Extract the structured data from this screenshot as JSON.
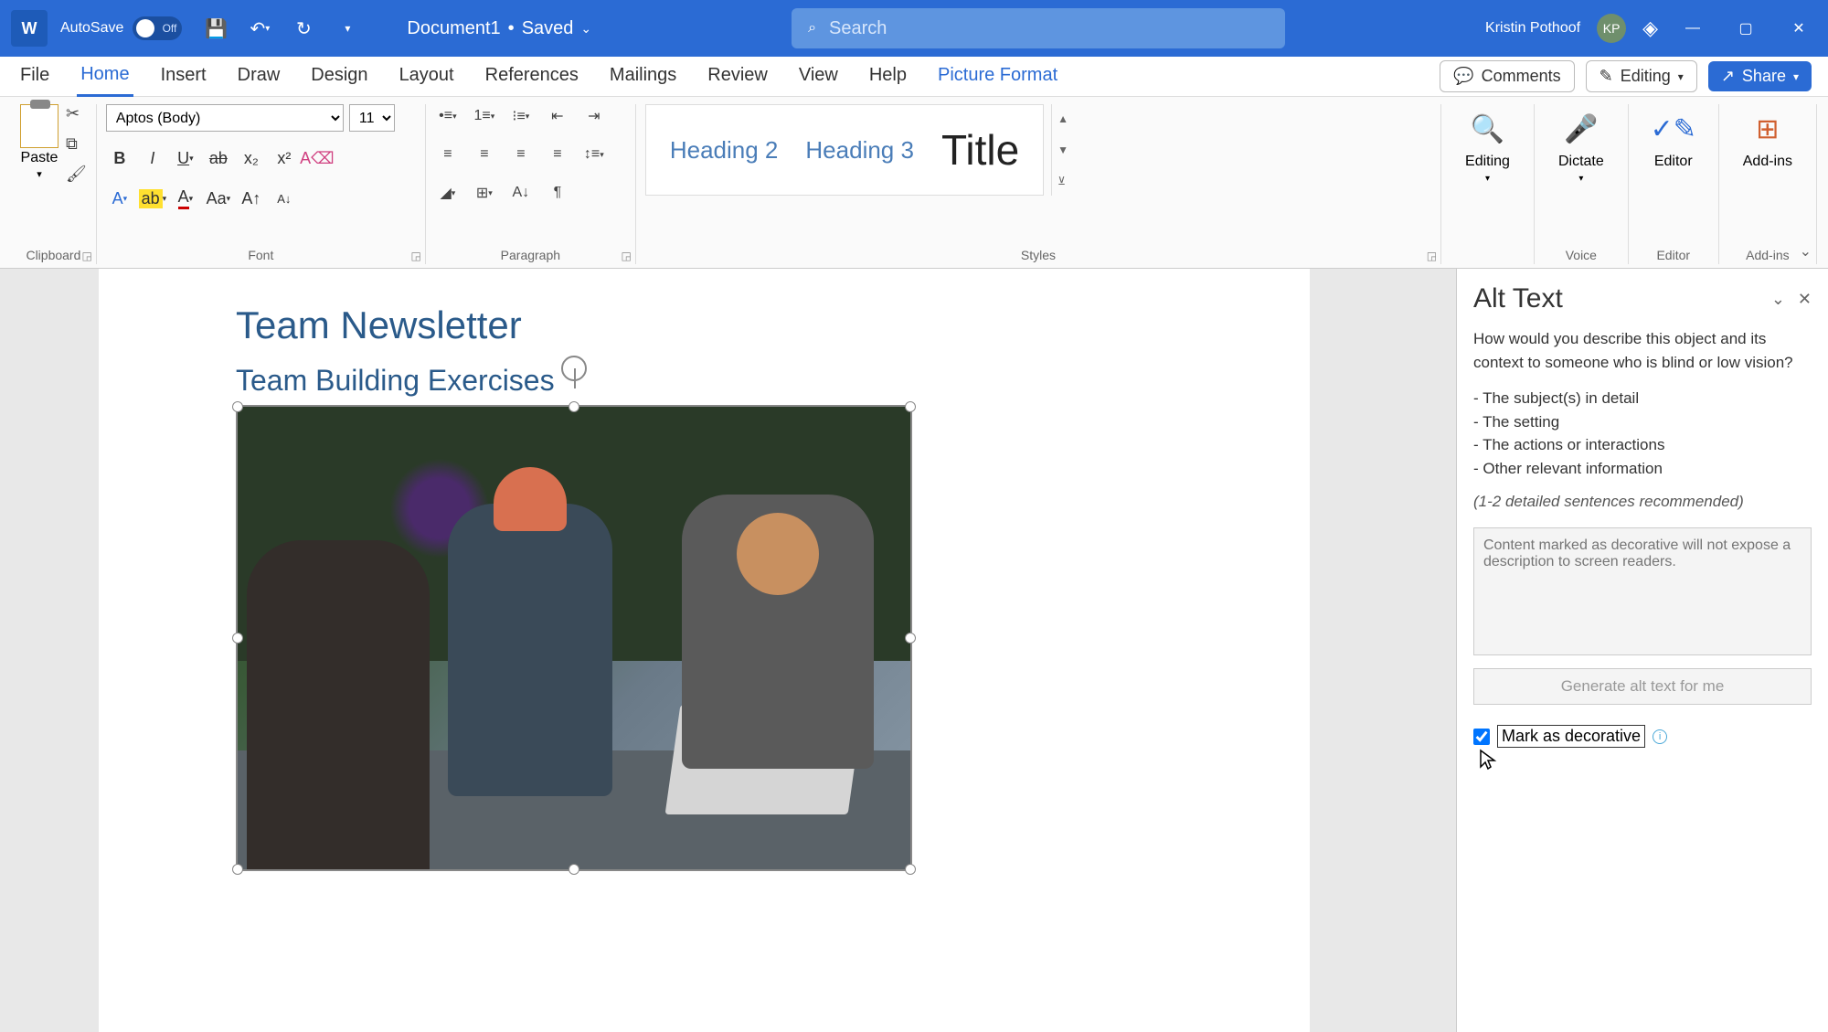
{
  "titlebar": {
    "app_icon": "W",
    "autosave_label": "AutoSave",
    "autosave_state": "Off",
    "document_name": "Document1",
    "save_status": "Saved",
    "search_placeholder": "Search",
    "user_name": "Kristin Pothoof",
    "user_initials": "KP"
  },
  "tabs": {
    "items": [
      "File",
      "Home",
      "Insert",
      "Draw",
      "Design",
      "Layout",
      "References",
      "Mailings",
      "Review",
      "View",
      "Help",
      "Picture Format"
    ],
    "active": "Home",
    "contextual": "Picture Format",
    "comments": "Comments",
    "editing": "Editing",
    "share": "Share"
  },
  "ribbon": {
    "clipboard": {
      "paste": "Paste",
      "label": "Clipboard"
    },
    "font": {
      "name": "Aptos (Body)",
      "size": "11",
      "label": "Font"
    },
    "paragraph": {
      "label": "Paragraph"
    },
    "styles": {
      "s1": "Heading 2",
      "s2": "Heading 3",
      "s3": "Title",
      "label": "Styles"
    },
    "editing": {
      "btn": "Editing",
      "label": ""
    },
    "voice": {
      "btn": "Dictate",
      "label": "Voice"
    },
    "editor": {
      "btn": "Editor",
      "label": "Editor"
    },
    "addins": {
      "btn": "Add-ins",
      "label": "Add-ins"
    }
  },
  "document": {
    "title": "Team Newsletter",
    "subtitle": "Team Building Exercises"
  },
  "pane": {
    "title": "Alt Text",
    "question": "How would you describe this object and its context to someone who is blind or low vision?",
    "bullet1": "- The subject(s) in detail",
    "bullet2": "- The setting",
    "bullet3": "- The actions or interactions",
    "bullet4": "- Other relevant information",
    "hint": "(1-2 detailed sentences recommended)",
    "textarea_placeholder": "Content marked as decorative will not expose a description to screen readers.",
    "generate": "Generate alt text for me",
    "decorative": "Mark as decorative"
  }
}
